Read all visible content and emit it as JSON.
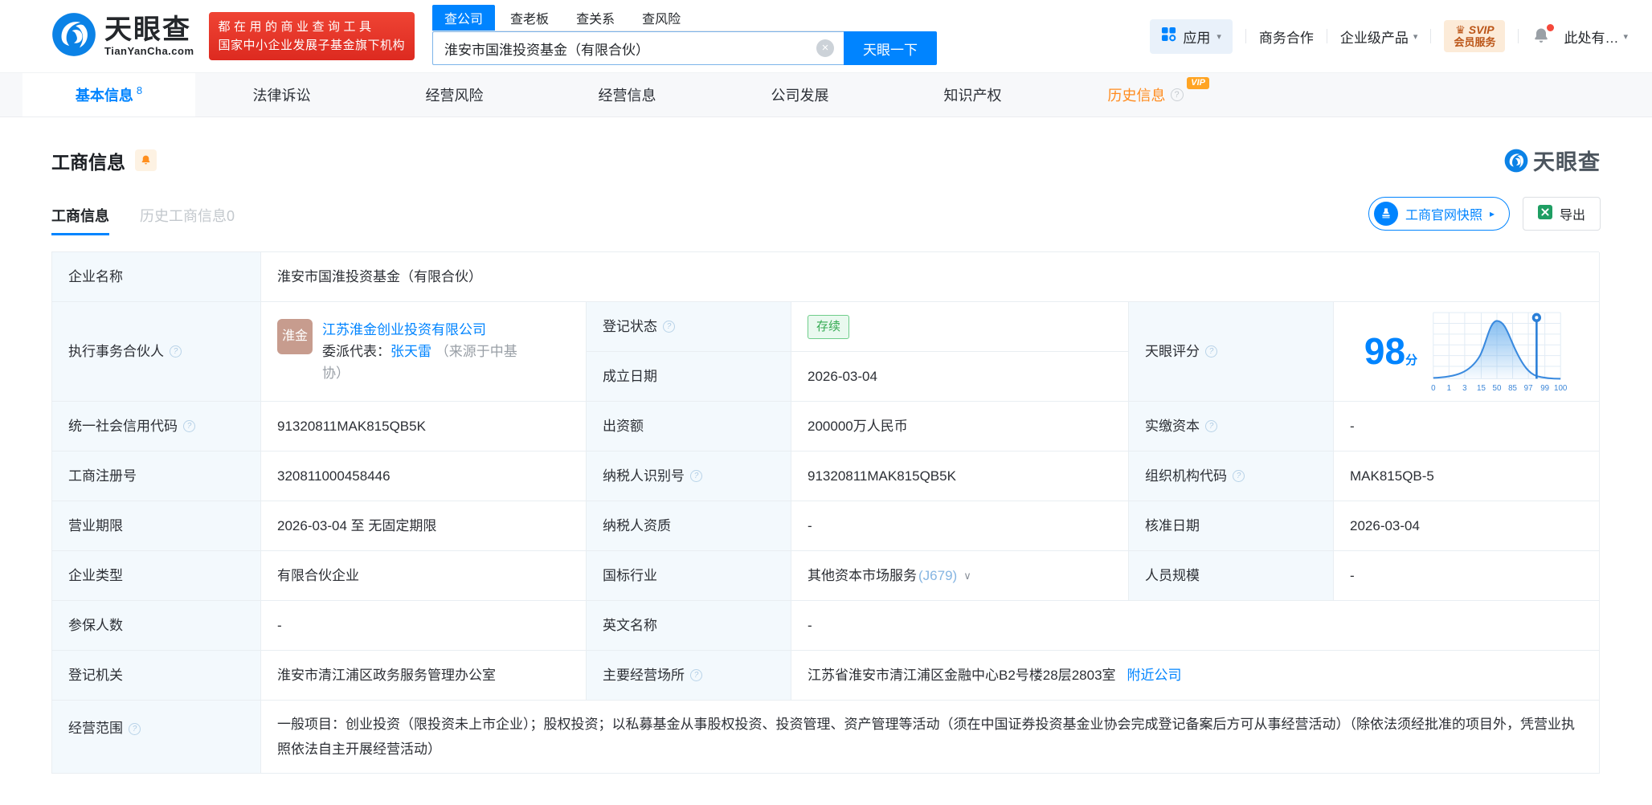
{
  "icons": {
    "help": "?",
    "caret": "▾",
    "chevron": "∨",
    "clear": "×",
    "arrow": "▸",
    "vip": "VIP",
    "crown": "♛",
    "ellipsis_menu": "…"
  },
  "header": {
    "logo_title": "天眼查",
    "logo_subtitle": "TianYanCha.com",
    "promo_line1": "都在用的商业查询工具",
    "promo_line2": "国家中小企业发展子基金旗下机构",
    "search_tabs": [
      {
        "label": "查公司",
        "active": true
      },
      {
        "label": "查老板",
        "active": false
      },
      {
        "label": "查关系",
        "active": false
      },
      {
        "label": "查风险",
        "active": false
      }
    ],
    "search_value": "淮安市国淮投资基金（有限合伙）",
    "search_button": "天眼一下",
    "apps_label": "应用",
    "nav_biz": "商务合作",
    "nav_enterprise": "企业级产品",
    "svip_line1": "SVIP",
    "svip_line2": "会员服务",
    "user_label": "此处有…"
  },
  "nav_tabs": [
    {
      "label": "基本信息",
      "count": "8",
      "active": true
    },
    {
      "label": "法律诉讼"
    },
    {
      "label": "经营风险"
    },
    {
      "label": "经营信息"
    },
    {
      "label": "公司发展"
    },
    {
      "label": "知识产权"
    },
    {
      "label": "历史信息",
      "vip": true
    }
  ],
  "section": {
    "title": "工商信息",
    "watermark": "天眼查",
    "subtabs": [
      {
        "label": "工商信息",
        "active": true
      },
      {
        "label": "历史工商信息0",
        "active": false
      }
    ],
    "snapshot_button": "工商官网快照",
    "export_button": "导出"
  },
  "table": {
    "company_name": {
      "label": "企业名称",
      "value": "淮安市国淮投资基金（有限合伙）"
    },
    "partner": {
      "label": "执行事务合伙人",
      "avatar": "淮金",
      "company": "江苏淮金创业投资有限公司",
      "delegate_label": "委派代表：",
      "delegate": "张天雷",
      "source": "（来源于中基协）"
    },
    "status": {
      "label": "登记状态",
      "value": "存续"
    },
    "established": {
      "label": "成立日期",
      "value": "2026-03-04"
    },
    "score": {
      "label": "天眼评分",
      "value": "98",
      "unit": "分"
    },
    "credit_code": {
      "label": "统一社会信用代码",
      "value": "91320811MAK815QB5K"
    },
    "capital": {
      "label": "出资额",
      "value": "200000万人民币"
    },
    "paid_capital": {
      "label": "实缴资本",
      "value": "-"
    },
    "reg_number": {
      "label": "工商注册号",
      "value": "320811000458446"
    },
    "tax_id": {
      "label": "纳税人识别号",
      "value": "91320811MAK815QB5K"
    },
    "org_code": {
      "label": "组织机构代码",
      "value": "MAK815QB-5"
    },
    "term": {
      "label": "营业期限",
      "value": "2026-03-04 至 无固定期限"
    },
    "tax_qualification": {
      "label": "纳税人资质",
      "value": "-"
    },
    "approval_date": {
      "label": "核准日期",
      "value": "2026-03-04"
    },
    "company_type": {
      "label": "企业类型",
      "value": "有限合伙企业"
    },
    "industry": {
      "label": "国标行业",
      "value": "其他资本市场服务",
      "code": "(J679)"
    },
    "staff_size": {
      "label": "人员规模",
      "value": "-"
    },
    "insured_count": {
      "label": "参保人数",
      "value": "-"
    },
    "english_name": {
      "label": "英文名称",
      "value": "-"
    },
    "registry": {
      "label": "登记机关",
      "value": "淮安市清江浦区政务服务管理办公室"
    },
    "business_address": {
      "label": "主要经营场所",
      "value": "江苏省淮安市清江浦区金融中心B2号楼28层2803室",
      "link": "附近公司"
    },
    "business_scope": {
      "label": "经营范围",
      "value": "一般项目：创业投资（限投资未上市企业）；股权投资；以私募基金从事股权投资、投资管理、资产管理等活动（须在中国证券投资基金业协会完成登记备案后方可从事经营活动）（除依法须经批准的项目外，凭营业执照依法自主开展经营活动）"
    }
  },
  "score_chart": {
    "type": "area",
    "score": 98,
    "ticks": [
      "0",
      "1",
      "3",
      "15",
      "50",
      "85",
      "97",
      "99",
      "100"
    ]
  }
}
